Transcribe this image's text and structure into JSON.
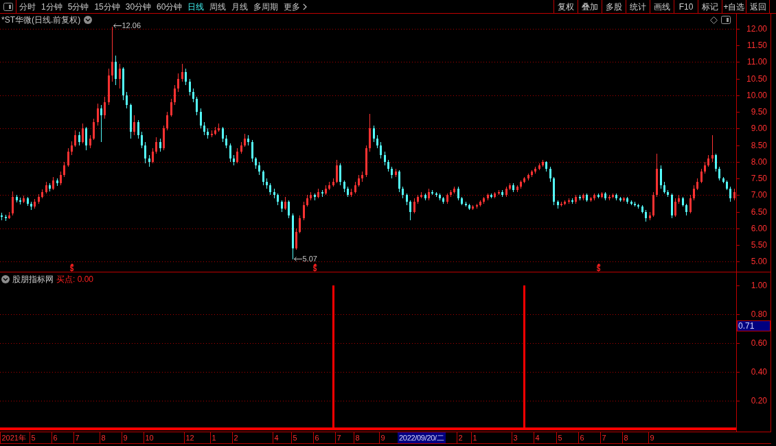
{
  "toolbar": {
    "periods": [
      {
        "label": "分时",
        "selected": false
      },
      {
        "label": "1分钟",
        "selected": false
      },
      {
        "label": "5分钟",
        "selected": false
      },
      {
        "label": "15分钟",
        "selected": false
      },
      {
        "label": "30分钟",
        "selected": false
      },
      {
        "label": "60分钟",
        "selected": false
      },
      {
        "label": "日线",
        "selected": true
      },
      {
        "label": "周线",
        "selected": false
      },
      {
        "label": "月线",
        "selected": false
      },
      {
        "label": "多周期",
        "selected": false
      }
    ],
    "more": "更多",
    "actions": [
      "复权",
      "叠加",
      "多股",
      "统计",
      "画线",
      "F10",
      "标记",
      "+自选",
      "返回"
    ]
  },
  "main_pane": {
    "title": "*ST华微(日线.前复权)",
    "signal_marks": [
      "$",
      "$",
      "$"
    ],
    "chart_data": {
      "type": "candlestick",
      "ylim": [
        4.7,
        12.45
      ],
      "grid": true,
      "annotations": [
        "12.06",
        "5.07"
      ],
      "yticks": [
        {
          "value": 5,
          "label": "5.00"
        },
        {
          "value": 5.5,
          "label": "5.50"
        },
        {
          "value": 6,
          "label": "6.00"
        },
        {
          "value": 6.5,
          "label": "6.50"
        },
        {
          "value": 7,
          "label": "7.00"
        },
        {
          "value": 7.5,
          "label": "7.50"
        },
        {
          "value": 8,
          "label": "8.00"
        },
        {
          "value": 8.5,
          "label": "8.50"
        },
        {
          "value": 9,
          "label": "9.00"
        },
        {
          "value": 9.5,
          "label": "9.50"
        },
        {
          "value": 10,
          "label": "10.00"
        },
        {
          "value": 10.5,
          "label": "10.50"
        },
        {
          "value": 11,
          "label": "11.00"
        },
        {
          "value": 11.5,
          "label": "11.50"
        },
        {
          "value": 12,
          "label": "12.00"
        }
      ],
      "ohlc": [
        [
          6.4,
          6.48,
          6.25,
          6.35
        ],
        [
          6.35,
          6.42,
          6.22,
          6.3
        ],
        [
          6.3,
          6.5,
          6.28,
          6.4
        ],
        [
          6.45,
          7.12,
          6.4,
          6.95
        ],
        [
          6.95,
          7.0,
          6.78,
          6.85
        ],
        [
          6.85,
          6.92,
          6.72,
          6.8
        ],
        [
          6.8,
          6.98,
          6.76,
          6.9
        ],
        [
          6.9,
          6.95,
          6.68,
          6.75
        ],
        [
          6.75,
          6.8,
          6.55,
          6.65
        ],
        [
          6.65,
          6.88,
          6.6,
          6.8
        ],
        [
          6.8,
          7.02,
          6.75,
          6.95
        ],
        [
          6.95,
          7.18,
          6.9,
          7.1
        ],
        [
          7.1,
          7.4,
          7.05,
          7.3
        ],
        [
          7.3,
          7.35,
          7.12,
          7.2
        ],
        [
          7.2,
          7.55,
          7.15,
          7.45
        ],
        [
          7.45,
          7.5,
          7.28,
          7.35
        ],
        [
          7.35,
          7.7,
          7.3,
          7.6
        ],
        [
          7.6,
          8.0,
          7.55,
          7.9
        ],
        [
          7.9,
          8.4,
          7.85,
          8.3
        ],
        [
          8.3,
          8.62,
          8.2,
          8.5
        ],
        [
          8.5,
          8.95,
          8.45,
          8.8
        ],
        [
          8.8,
          8.9,
          8.5,
          8.6
        ],
        [
          8.6,
          9.15,
          8.55,
          9.0
        ],
        [
          9.0,
          9.05,
          8.35,
          8.5
        ],
        [
          8.5,
          8.8,
          8.4,
          8.7
        ],
        [
          8.7,
          9.3,
          8.65,
          9.2
        ],
        [
          9.2,
          9.75,
          9.1,
          9.6
        ],
        [
          9.6,
          9.7,
          8.6,
          9.4
        ],
        [
          9.4,
          9.95,
          9.3,
          9.8
        ],
        [
          9.8,
          10.8,
          9.7,
          10.6
        ],
        [
          10.6,
          12.06,
          10.4,
          11.0
        ],
        [
          11.0,
          11.2,
          10.3,
          10.5
        ],
        [
          10.5,
          10.95,
          10.2,
          10.8
        ],
        [
          10.8,
          10.85,
          9.85,
          10.0
        ],
        [
          10.0,
          10.1,
          9.6,
          9.7
        ],
        [
          9.7,
          9.75,
          8.7,
          8.9
        ],
        [
          8.9,
          9.4,
          8.8,
          9.2
        ],
        [
          9.2,
          9.25,
          8.7,
          8.8
        ],
        [
          8.8,
          8.9,
          8.4,
          8.5
        ],
        [
          8.5,
          8.6,
          7.95,
          8.1
        ],
        [
          8.1,
          8.2,
          7.85,
          8.0
        ],
        [
          8.0,
          8.4,
          7.95,
          8.3
        ],
        [
          8.3,
          8.75,
          8.25,
          8.6
        ],
        [
          8.6,
          8.7,
          8.3,
          8.4
        ],
        [
          8.4,
          9.1,
          8.35,
          9.0
        ],
        [
          9.0,
          9.5,
          8.95,
          9.4
        ],
        [
          9.4,
          9.9,
          9.35,
          9.8
        ],
        [
          9.8,
          10.3,
          9.7,
          10.2
        ],
        [
          10.2,
          10.65,
          10.1,
          10.5
        ],
        [
          10.5,
          10.95,
          10.4,
          10.7
        ],
        [
          10.7,
          10.8,
          10.3,
          10.4
        ],
        [
          10.4,
          10.5,
          10.0,
          10.1
        ],
        [
          10.1,
          10.2,
          9.8,
          9.9
        ],
        [
          9.9,
          9.95,
          9.4,
          9.5
        ],
        [
          9.5,
          9.6,
          9.0,
          9.1
        ],
        [
          9.1,
          9.2,
          8.8,
          8.9
        ],
        [
          8.9,
          9.0,
          8.7,
          8.8
        ],
        [
          8.8,
          8.95,
          8.75,
          8.85
        ],
        [
          8.85,
          9.05,
          8.8,
          8.95
        ],
        [
          8.95,
          9.15,
          8.9,
          9.0
        ],
        [
          9.0,
          9.05,
          8.6,
          8.7
        ],
        [
          8.7,
          8.8,
          8.4,
          8.5
        ],
        [
          8.5,
          8.55,
          8.0,
          8.1
        ],
        [
          8.1,
          8.2,
          7.9,
          8.0
        ],
        [
          8.0,
          8.4,
          7.95,
          8.3
        ],
        [
          8.3,
          8.6,
          8.25,
          8.5
        ],
        [
          8.5,
          8.85,
          8.45,
          8.7
        ],
        [
          8.7,
          8.8,
          8.5,
          8.6
        ],
        [
          8.6,
          8.65,
          8.0,
          8.1
        ],
        [
          8.1,
          8.15,
          7.8,
          7.9
        ],
        [
          7.9,
          8.0,
          7.6,
          7.7
        ],
        [
          7.7,
          7.75,
          7.3,
          7.4
        ],
        [
          7.4,
          7.5,
          7.2,
          7.3
        ],
        [
          7.3,
          7.35,
          7.0,
          7.1
        ],
        [
          7.1,
          7.2,
          6.9,
          7.0
        ],
        [
          7.0,
          7.05,
          6.7,
          6.8
        ],
        [
          6.8,
          6.85,
          6.5,
          6.6
        ],
        [
          6.6,
          6.95,
          6.55,
          6.8
        ],
        [
          6.8,
          6.85,
          6.3,
          6.4
        ],
        [
          6.4,
          6.45,
          5.07,
          5.4
        ],
        [
          5.4,
          6.0,
          5.35,
          5.9
        ],
        [
          5.9,
          6.4,
          5.85,
          6.3
        ],
        [
          6.3,
          6.8,
          6.25,
          6.7
        ],
        [
          6.7,
          7.0,
          6.65,
          6.9
        ],
        [
          6.9,
          7.1,
          6.85,
          7.0
        ],
        [
          7.0,
          7.05,
          6.85,
          6.95
        ],
        [
          6.95,
          7.2,
          6.9,
          7.1
        ],
        [
          7.1,
          7.15,
          6.95,
          7.05
        ],
        [
          7.05,
          7.3,
          7.0,
          7.2
        ],
        [
          7.2,
          7.4,
          7.15,
          7.3
        ],
        [
          7.3,
          7.5,
          7.25,
          7.4
        ],
        [
          7.4,
          8.05,
          7.35,
          7.9
        ],
        [
          7.9,
          7.95,
          7.3,
          7.4
        ],
        [
          7.4,
          7.45,
          7.1,
          7.2
        ],
        [
          7.2,
          7.25,
          6.95,
          7.0
        ],
        [
          7.0,
          7.2,
          6.95,
          7.1
        ],
        [
          7.1,
          7.4,
          7.05,
          7.3
        ],
        [
          7.3,
          7.6,
          7.25,
          7.5
        ],
        [
          7.5,
          7.7,
          7.4,
          7.6
        ],
        [
          7.6,
          8.5,
          7.55,
          8.4
        ],
        [
          8.4,
          9.45,
          8.3,
          9.0
        ],
        [
          9.0,
          9.1,
          8.6,
          8.7
        ],
        [
          8.7,
          8.8,
          8.4,
          8.5
        ],
        [
          8.5,
          8.6,
          8.1,
          8.2
        ],
        [
          8.2,
          8.3,
          7.9,
          8.0
        ],
        [
          8.0,
          8.05,
          7.7,
          7.8
        ],
        [
          7.8,
          7.85,
          7.5,
          7.6
        ],
        [
          7.6,
          7.8,
          7.55,
          7.7
        ],
        [
          7.7,
          7.75,
          7.1,
          7.2
        ],
        [
          7.2,
          7.25,
          6.9,
          7.0
        ],
        [
          7.0,
          7.05,
          6.7,
          6.8
        ],
        [
          6.8,
          6.85,
          6.25,
          6.5
        ],
        [
          6.5,
          6.9,
          6.45,
          6.8
        ],
        [
          6.8,
          7.0,
          6.75,
          6.95
        ],
        [
          6.95,
          7.1,
          6.9,
          7.0
        ],
        [
          7.0,
          7.05,
          6.85,
          6.9
        ],
        [
          6.9,
          7.2,
          6.85,
          7.1
        ],
        [
          7.1,
          7.15,
          7.0,
          7.05
        ],
        [
          7.05,
          7.1,
          6.95,
          7.0
        ],
        [
          7.0,
          7.05,
          6.85,
          6.9
        ],
        [
          6.9,
          6.95,
          6.75,
          6.8
        ],
        [
          6.8,
          7.05,
          6.75,
          7.0
        ],
        [
          7.0,
          7.15,
          6.95,
          7.1
        ],
        [
          7.1,
          7.25,
          7.05,
          7.2
        ],
        [
          7.2,
          7.25,
          6.85,
          6.9
        ],
        [
          6.9,
          6.95,
          6.7,
          6.75
        ],
        [
          6.75,
          6.8,
          6.65,
          6.7
        ],
        [
          6.7,
          6.75,
          6.55,
          6.6
        ],
        [
          6.6,
          6.7,
          6.55,
          6.65
        ],
        [
          6.65,
          6.75,
          6.6,
          6.7
        ],
        [
          6.7,
          6.85,
          6.65,
          6.8
        ],
        [
          6.8,
          6.95,
          6.75,
          6.9
        ],
        [
          6.9,
          7.05,
          6.85,
          7.0
        ],
        [
          7.0,
          7.05,
          6.9,
          6.95
        ],
        [
          6.95,
          7.1,
          6.9,
          7.05
        ],
        [
          7.05,
          7.15,
          7.0,
          7.1
        ],
        [
          7.1,
          7.15,
          6.95,
          7.0
        ],
        [
          7.0,
          7.25,
          6.95,
          7.2
        ],
        [
          7.2,
          7.35,
          7.15,
          7.3
        ],
        [
          7.3,
          7.35,
          7.1,
          7.15
        ],
        [
          7.15,
          7.3,
          7.1,
          7.25
        ],
        [
          7.25,
          7.45,
          7.2,
          7.4
        ],
        [
          7.4,
          7.55,
          7.35,
          7.5
        ],
        [
          7.5,
          7.65,
          7.45,
          7.6
        ],
        [
          7.6,
          7.75,
          7.55,
          7.7
        ],
        [
          7.7,
          7.85,
          7.65,
          7.8
        ],
        [
          7.8,
          7.95,
          7.75,
          7.9
        ],
        [
          7.9,
          8.05,
          7.85,
          8.0
        ],
        [
          8.0,
          8.02,
          7.7,
          7.8
        ],
        [
          7.8,
          7.85,
          7.4,
          7.5
        ],
        [
          7.5,
          7.55,
          6.7,
          6.8
        ],
        [
          6.8,
          6.85,
          6.6,
          6.7
        ],
        [
          6.7,
          6.8,
          6.65,
          6.75
        ],
        [
          6.75,
          6.85,
          6.7,
          6.8
        ],
        [
          6.8,
          6.9,
          6.75,
          6.85
        ],
        [
          6.85,
          6.9,
          6.75,
          6.8
        ],
        [
          6.8,
          7.0,
          6.75,
          6.95
        ],
        [
          6.95,
          7.0,
          6.85,
          6.9
        ],
        [
          6.9,
          7.05,
          6.85,
          7.0
        ],
        [
          7.0,
          7.05,
          6.8,
          6.85
        ],
        [
          6.85,
          6.95,
          6.8,
          6.9
        ],
        [
          6.9,
          7.05,
          6.85,
          7.0
        ],
        [
          7.0,
          7.05,
          6.9,
          6.95
        ],
        [
          6.95,
          7.1,
          6.9,
          7.05
        ],
        [
          7.05,
          7.1,
          6.85,
          6.9
        ],
        [
          6.9,
          7.0,
          6.85,
          6.95
        ],
        [
          6.95,
          7.05,
          6.9,
          7.0
        ],
        [
          7.0,
          7.05,
          6.85,
          6.9
        ],
        [
          6.9,
          6.95,
          6.8,
          6.85
        ],
        [
          6.85,
          6.95,
          6.8,
          6.9
        ],
        [
          6.9,
          6.95,
          6.75,
          6.8
        ],
        [
          6.8,
          6.85,
          6.7,
          6.75
        ],
        [
          6.75,
          6.8,
          6.65,
          6.7
        ],
        [
          6.7,
          6.75,
          6.6,
          6.65
        ],
        [
          6.65,
          6.7,
          6.45,
          6.5
        ],
        [
          6.5,
          6.55,
          6.2,
          6.3
        ],
        [
          6.3,
          6.5,
          6.25,
          6.4
        ],
        [
          6.4,
          7.1,
          6.35,
          7.0
        ],
        [
          7.0,
          8.25,
          6.95,
          7.8
        ],
        [
          7.8,
          7.9,
          7.2,
          7.3
        ],
        [
          7.3,
          7.4,
          7.05,
          7.1
        ],
        [
          7.1,
          7.15,
          6.95,
          7.0
        ],
        [
          7.0,
          7.05,
          6.3,
          6.4
        ],
        [
          6.4,
          6.9,
          6.35,
          6.8
        ],
        [
          6.8,
          7.0,
          6.75,
          6.9
        ],
        [
          6.9,
          6.95,
          6.65,
          6.7
        ],
        [
          6.7,
          6.75,
          6.4,
          6.5
        ],
        [
          6.5,
          7.0,
          6.45,
          6.9
        ],
        [
          6.9,
          7.3,
          6.85,
          7.2
        ],
        [
          7.2,
          7.5,
          7.15,
          7.4
        ],
        [
          7.4,
          7.8,
          7.35,
          7.7
        ],
        [
          7.7,
          8.0,
          7.65,
          7.9
        ],
        [
          7.9,
          8.2,
          7.85,
          8.1
        ],
        [
          8.1,
          8.8,
          8.0,
          8.2
        ],
        [
          8.2,
          8.25,
          7.7,
          7.8
        ],
        [
          7.8,
          7.85,
          7.45,
          7.5
        ],
        [
          7.5,
          7.55,
          7.35,
          7.4
        ],
        [
          7.4,
          7.45,
          7.15,
          7.2
        ],
        [
          7.2,
          7.25,
          6.8,
          6.9
        ],
        [
          6.9,
          7.2,
          6.85,
          7.1
        ]
      ]
    }
  },
  "indicator_pane": {
    "name": "股朋指标网",
    "readout": "买点: 0.00",
    "chart_data": {
      "type": "bar",
      "color": "#ff0000",
      "ylim": [
        0,
        1.09
      ],
      "grid": true,
      "yticks": [
        {
          "value": 0.2,
          "label": "0.20"
        },
        {
          "value": 0.4,
          "label": "0.40"
        },
        {
          "value": 0.6,
          "label": "0.60"
        },
        {
          "value": 0.8,
          "label": "0.80"
        },
        {
          "value": 1,
          "label": "1.00"
        }
      ],
      "categories": [
        "2021年",
        null,
        null,
        null,
        null,
        null,
        null,
        null,
        "5",
        null,
        null,
        null,
        null,
        null,
        "6",
        null,
        null,
        null,
        null,
        null,
        "7",
        null,
        null,
        null,
        null,
        null,
        null,
        "8",
        null,
        null,
        null,
        null,
        null,
        "9",
        null,
        null,
        null,
        null,
        null,
        "10",
        null,
        null,
        null,
        null,
        null,
        null,
        null,
        null,
        null,
        null,
        "12",
        null,
        null,
        null,
        null,
        null,
        null,
        "1",
        null,
        null,
        null,
        null,
        null,
        "2",
        null,
        null,
        null,
        null,
        null,
        null,
        null,
        null,
        null,
        null,
        "4",
        null,
        null,
        null,
        null,
        "5",
        null,
        null,
        null,
        null,
        null,
        "6",
        null,
        null,
        null,
        null,
        null,
        "7",
        null,
        null,
        null,
        null,
        "8",
        null,
        null,
        null,
        null,
        null,
        null,
        "9",
        null,
        null,
        null,
        null,
        null,
        null,
        null,
        null,
        null,
        null,
        null,
        null,
        null,
        null,
        null,
        null,
        null,
        null,
        null,
        null,
        "2",
        null,
        null,
        null,
        "1",
        null,
        null,
        null,
        null,
        null,
        null,
        null,
        null,
        null,
        null,
        "3",
        null,
        null,
        null,
        null,
        null,
        "4",
        null,
        null,
        null,
        null,
        null,
        "5",
        null,
        null,
        null,
        null,
        null,
        "6",
        null,
        null,
        null,
        null,
        null,
        "7",
        null,
        null,
        null,
        null,
        null,
        "8",
        null,
        null,
        null,
        null,
        null,
        null,
        "9",
        null,
        null,
        null,
        null,
        null,
        null,
        null,
        null,
        null,
        null,
        null,
        null,
        null,
        null,
        null,
        null,
        null,
        null,
        null,
        null,
        null,
        null,
        null
      ],
      "values": [
        0,
        0,
        0,
        0,
        0,
        0,
        0,
        0,
        0,
        0,
        0,
        0,
        0,
        0,
        0,
        0,
        0,
        0,
        0,
        0,
        0,
        0,
        0,
        0,
        0,
        0,
        0,
        0,
        0,
        0,
        0,
        0,
        0,
        0,
        0,
        0,
        0,
        0,
        0,
        0,
        0,
        0,
        0,
        0,
        0,
        0,
        0,
        0,
        0,
        0,
        0,
        0,
        0,
        0,
        0,
        0,
        0,
        0,
        0,
        0,
        0,
        0,
        0,
        0,
        0,
        0,
        0,
        0,
        0,
        0,
        0,
        0,
        0,
        0,
        0,
        0,
        0,
        0,
        0,
        0,
        0,
        0,
        0,
        0,
        0,
        0,
        0,
        0,
        0,
        0,
        1,
        0,
        0,
        0,
        0,
        0,
        0,
        0,
        0,
        0,
        0,
        0,
        0,
        0,
        0,
        0,
        0,
        0,
        0,
        0,
        0,
        0,
        0,
        0,
        0,
        0,
        0,
        0,
        0,
        0,
        0,
        0,
        0,
        0,
        0,
        0,
        0,
        0,
        0,
        0,
        0,
        0,
        0,
        0,
        0,
        0,
        0,
        0,
        0,
        0,
        0,
        0,
        1,
        0,
        0,
        0,
        0,
        0,
        0,
        0,
        0,
        0,
        0,
        0,
        0,
        0,
        0,
        0,
        0,
        0,
        0,
        0,
        0,
        0,
        0,
        0,
        0,
        0,
        0,
        0,
        0,
        0,
        0,
        0,
        0,
        0,
        0,
        0,
        0,
        0,
        0,
        0,
        0,
        0,
        0,
        0,
        0,
        0,
        0,
        0,
        0,
        0,
        0,
        0,
        0,
        0,
        0,
        0,
        0,
        0
      ]
    }
  },
  "crosshair": {
    "date": "2022/09/20/二",
    "value": "0.71"
  }
}
